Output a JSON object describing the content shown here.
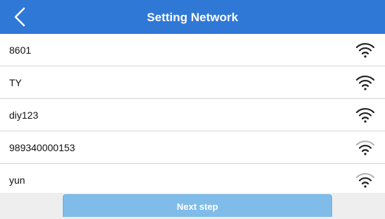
{
  "header": {
    "title": "Setting Network",
    "background": "#2f78d6",
    "back_icon": "chevron-left-icon"
  },
  "networks": [
    {
      "ssid": "8601",
      "signal_icon": "wifi-icon",
      "signal": "strong"
    },
    {
      "ssid": "TY",
      "signal_icon": "wifi-icon",
      "signal": "strong"
    },
    {
      "ssid": "diy123",
      "signal_icon": "wifi-icon",
      "signal": "strong"
    },
    {
      "ssid": "989340000153",
      "signal_icon": "wifi-icon",
      "signal": "weak"
    },
    {
      "ssid": "yun",
      "signal_icon": "wifi-icon",
      "signal": "weak"
    }
  ],
  "footer": {
    "next_label": "Next step",
    "button_color": "#7fbcea"
  }
}
